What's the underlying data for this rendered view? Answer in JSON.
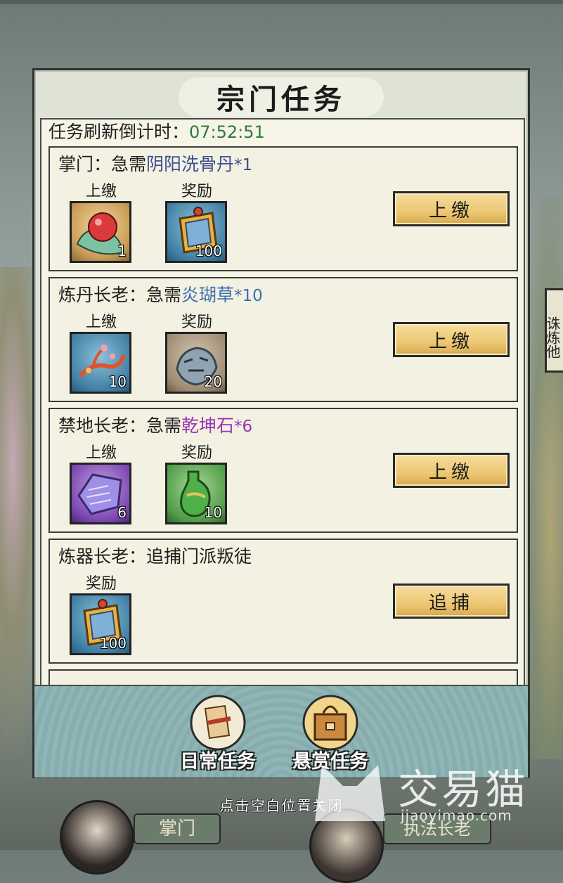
{
  "panel": {
    "title": "宗门任务",
    "timer_label": "任务刷新倒计时：",
    "timer_value": "07:52:51"
  },
  "tasks": [
    {
      "prefix": "掌门：急需",
      "item": "阴阳洗骨丹",
      "qty": "*1",
      "item_color": "#3f4f8e",
      "submit_label": "上缴",
      "submit_icon": "red-pill-icon",
      "submit_count": "1",
      "reward_label": "奖励",
      "reward_icon": "sect-token-icon",
      "reward_count": "100",
      "action": "上缴"
    },
    {
      "prefix": "炼丹长老：急需",
      "item": "炎瑚草",
      "qty": "*10",
      "item_color": "#3c6fb0",
      "submit_label": "上缴",
      "submit_icon": "coral-herb-icon",
      "submit_count": "10",
      "reward_label": "奖励",
      "reward_icon": "tiger-armor-icon",
      "reward_count": "20",
      "action": "上缴"
    },
    {
      "prefix": "禁地长老：急需",
      "item": "乾坤石",
      "qty": "*6",
      "item_color": "#9a33b5",
      "submit_label": "上缴",
      "submit_icon": "purple-stone-icon",
      "submit_count": "6",
      "reward_label": "奖励",
      "reward_icon": "jade-gourd-icon",
      "reward_count": "10",
      "action": "上缴"
    },
    {
      "prefix": "炼器长老：追捕门派叛徒",
      "reward_label": "奖励",
      "reward_icon": "sect-token-icon",
      "reward_count": "100",
      "action": "追捕"
    }
  ],
  "tabs": {
    "daily": "日常任务",
    "bounty": "悬赏任务"
  },
  "close_hint": "点击空白位置关闭",
  "footer": {
    "left_label": "掌门",
    "right_label": "执法长老"
  },
  "side_tab": "诛炼他",
  "watermark": {
    "text": "交易猫",
    "url": "jiaoyimao.com"
  }
}
